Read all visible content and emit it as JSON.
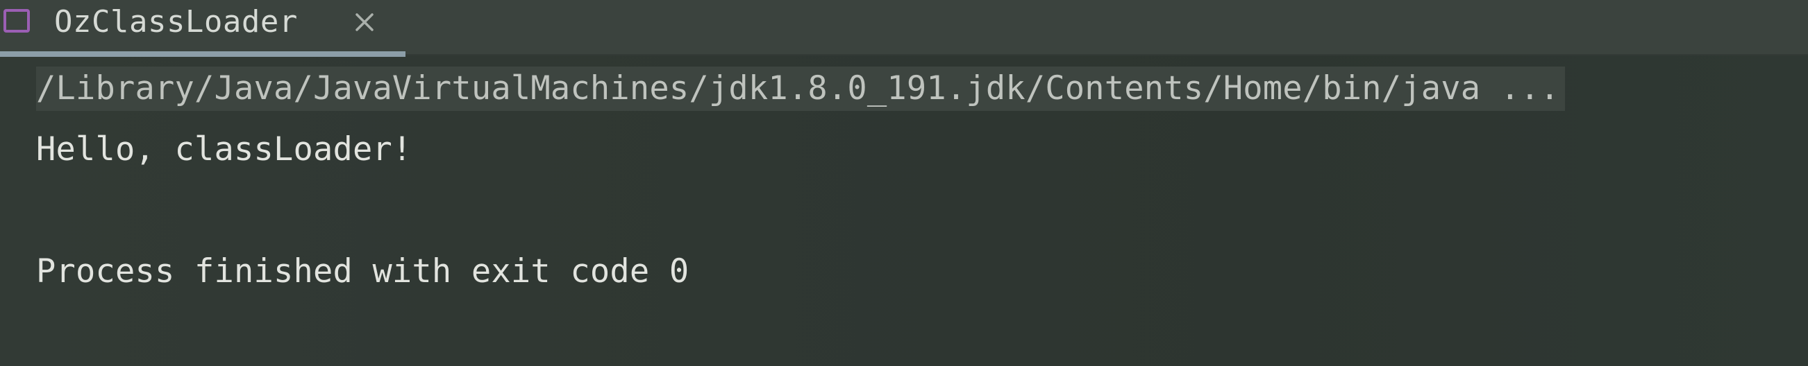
{
  "tab": {
    "title": "OzClassLoader",
    "close_glyph": "×",
    "icon": "console-window-icon",
    "icon_color": "#9b5fb4"
  },
  "console": {
    "command_line": "/Library/Java/JavaVirtualMachines/jdk1.8.0_191.jdk/Contents/Home/bin/java ...",
    "lines": [
      "Hello, classLoader!",
      "Process finished with exit code 0"
    ]
  },
  "colors": {
    "background": "#2e3631",
    "tab_bar": "#3b433e",
    "tab_underline": "#8c9ea8",
    "text": "#e2e4df",
    "command_highlight": "#3d4540"
  }
}
